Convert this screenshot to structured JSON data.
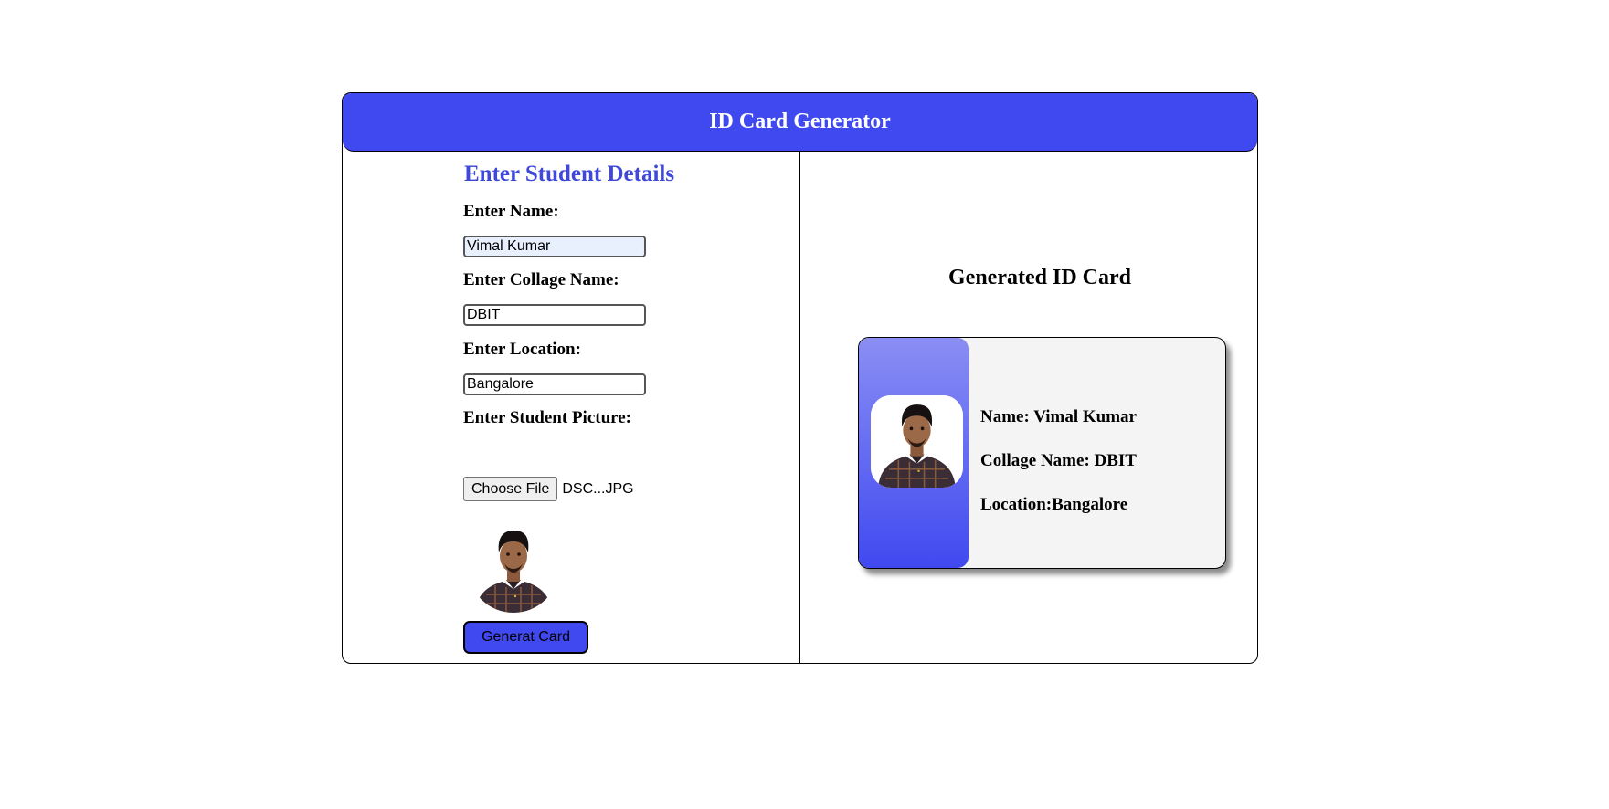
{
  "header": {
    "title": "ID Card Generator"
  },
  "form": {
    "title": "Enter Student Details",
    "name_label": "Enter Name:",
    "name_value": "Vimal Kumar",
    "college_label": "Enter Collage Name:",
    "college_value": "DBIT",
    "location_label": "Enter Location:",
    "location_value": "Bangalore",
    "picture_label": "Enter Student Picture:",
    "file_button": "Choose File",
    "file_name": "DSC...JPG",
    "generate_button": "Generat Card"
  },
  "card": {
    "title": "Generated ID Card",
    "name_line": "Name: Vimal Kumar",
    "college_line": "Collage Name: DBIT",
    "location_line": "Location:Bangalore"
  },
  "colors": {
    "accent": "#4049f0",
    "title_blue": "#3f48d8",
    "card_bg": "#f4f4f4"
  }
}
